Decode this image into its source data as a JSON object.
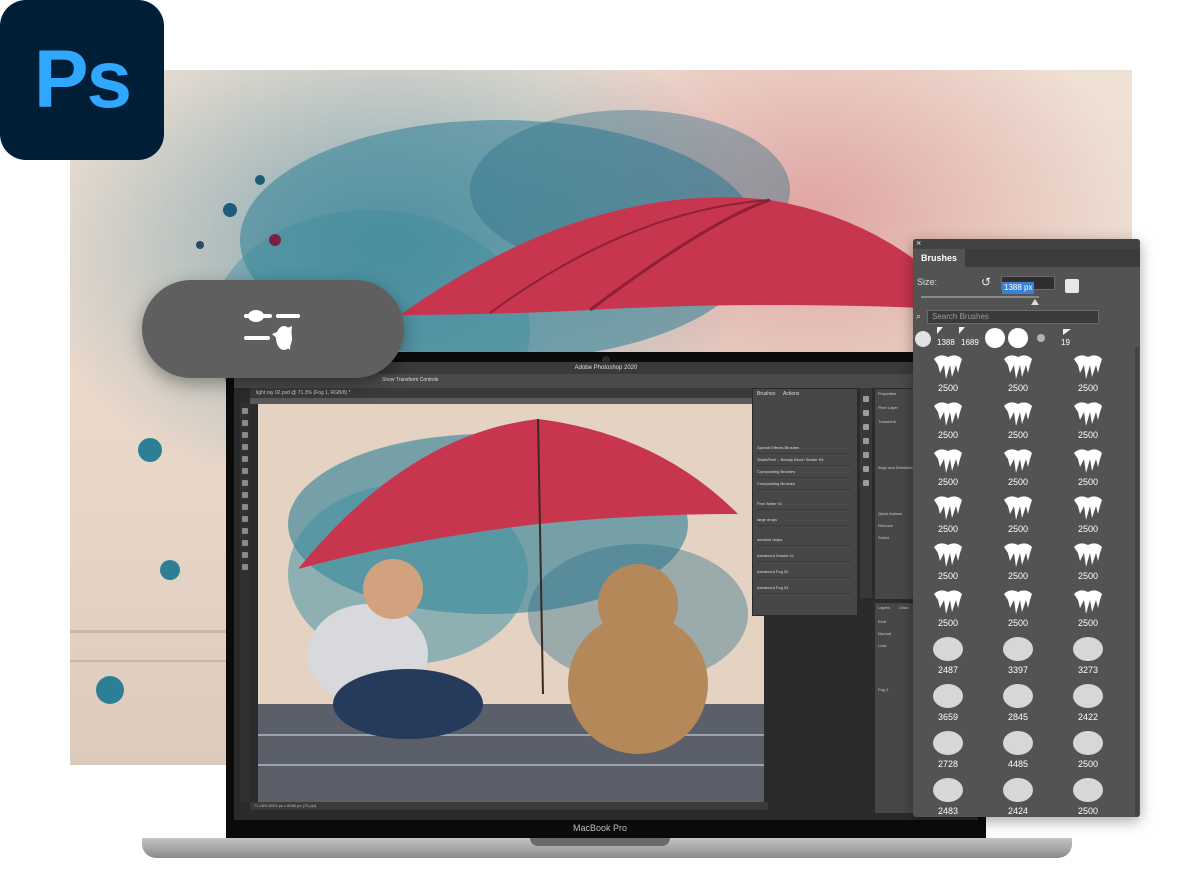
{
  "logo": {
    "text": "Ps"
  },
  "laptop": {
    "title": "Adobe Photoshop 2020",
    "model_label": "MacBook Pro",
    "document_tab": "light ray 02.psd @ 71.3% (Fog 1, RGB/8) *",
    "options_label": "Show Transform Controls",
    "status": "71.28%     6024 px x 8066 px (72 ppi)",
    "mini_brushes": {
      "tabs": [
        "Brushes",
        "Actions"
      ],
      "rows": [
        "Special Effects Brushes",
        "SharkPixel – Beauty Brush Starter Kit",
        "Compositing Brushes",
        "Compositing Brushes",
        "Fine Water 01",
        "large drops",
        "medium drops",
        "Advanced Smoke 01",
        "Advanced Fog 02",
        "Advanced Fog 03"
      ]
    },
    "mini_properties": {
      "tabs": [
        "Properties"
      ],
      "items": [
        "Pixel Layer",
        "Transform",
        "Align and Distribute",
        "Quick Actions",
        "Remove",
        "Select"
      ]
    },
    "mini_layers": {
      "tabs": [
        "Layers",
        "Chan"
      ],
      "items": [
        "Kind",
        "Normal",
        "Lock",
        "Fog 1"
      ]
    }
  },
  "brushes_panel": {
    "tab": "Brushes",
    "close_glyph": "×",
    "size_label": "Size:",
    "size_value": "1388 px",
    "search_placeholder": "Search Brushes",
    "size_slider_fraction": 0.97,
    "recent": [
      "1388",
      "1689",
      "19"
    ],
    "grid": [
      "2500",
      "2500",
      "2500",
      "2500",
      "2500",
      "2500",
      "2500",
      "2500",
      "2500",
      "2500",
      "2500",
      "2500",
      "2500",
      "2500",
      "2500",
      "2500",
      "2500",
      "2500",
      "2487",
      "3397",
      "3273",
      "3659",
      "2845",
      "2422",
      "2728",
      "4485",
      "2500",
      "2483",
      "2424",
      "2500"
    ]
  },
  "colors": {
    "accent": "#31a8ff",
    "logo_bg": "#001e36",
    "umbrella": "#c8354f",
    "panel": "#535353"
  }
}
